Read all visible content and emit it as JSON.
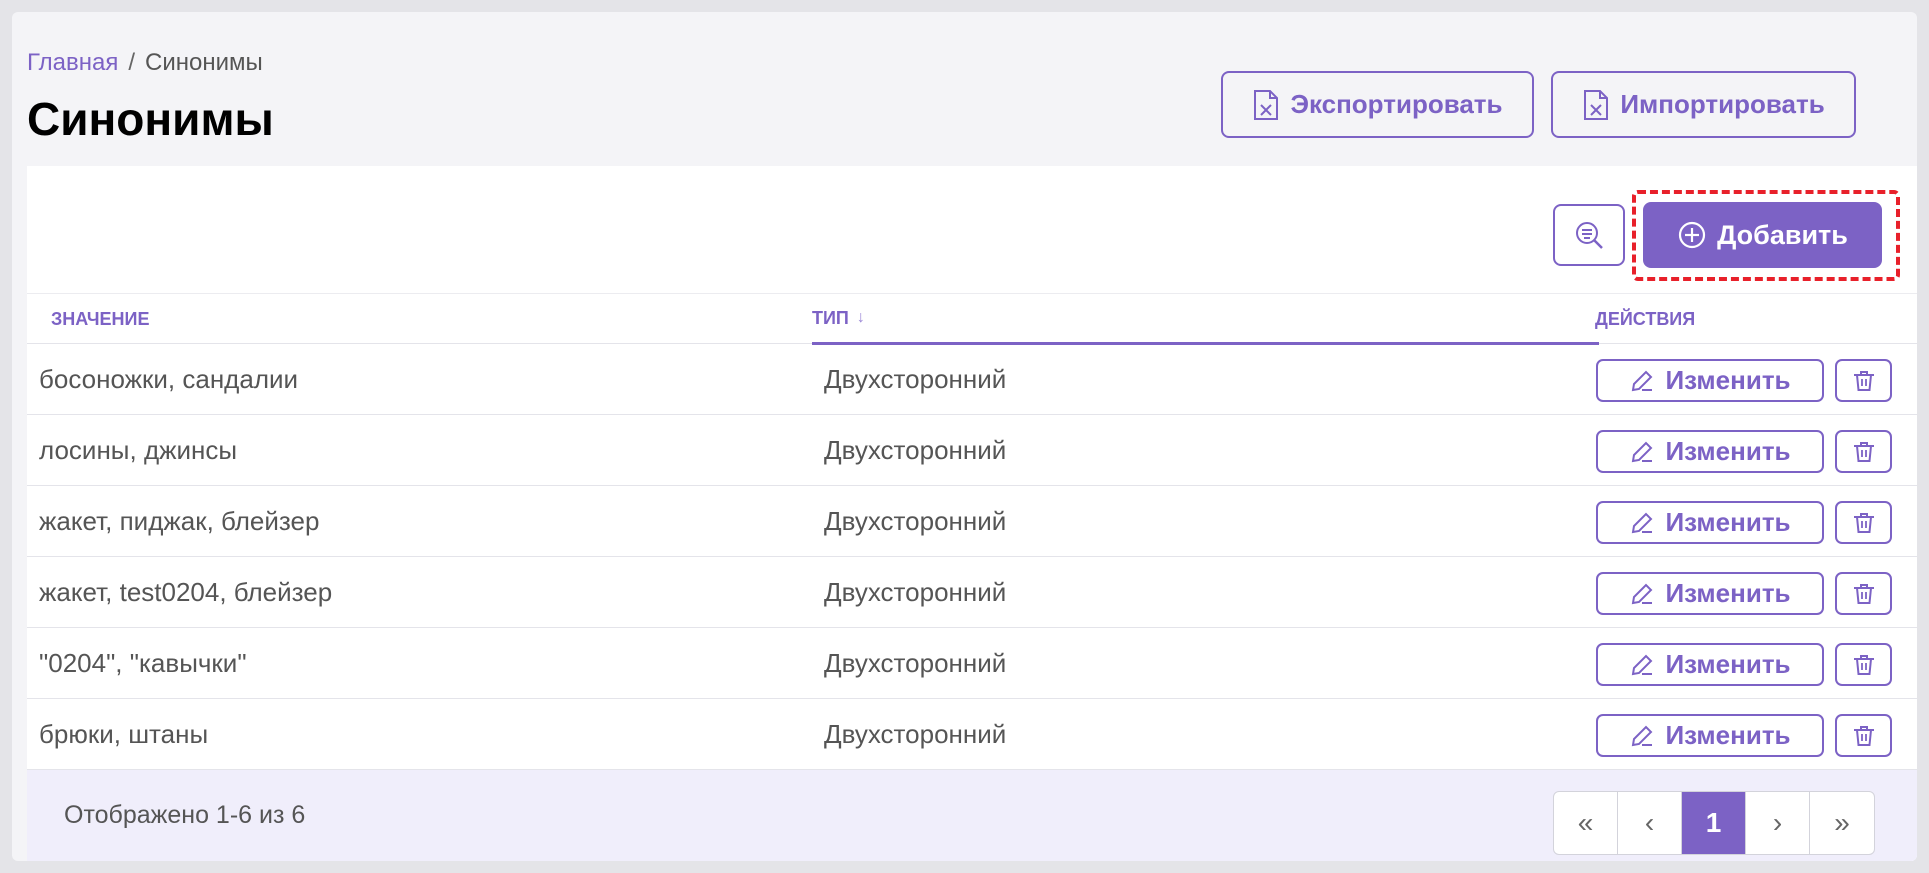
{
  "breadcrumb": {
    "home": "Главная",
    "separator": "/",
    "current": "Синонимы"
  },
  "page": {
    "title": "Синонимы"
  },
  "toolbar": {
    "export_label": "Экспортировать",
    "import_label": "Импортировать",
    "add_label": "Добавить"
  },
  "table": {
    "headers": {
      "value": "Значение",
      "type": "Тип",
      "type_sort_glyph": "↓",
      "actions": "Действия"
    },
    "rows": [
      {
        "value": "босоножки, сандалии",
        "type": "Двухсторонний",
        "edit_label": "Изменить"
      },
      {
        "value": "лосины, джинсы",
        "type": "Двухсторонний",
        "edit_label": "Изменить"
      },
      {
        "value": "жакет, пиджак, блейзер",
        "type": "Двухсторонний",
        "edit_label": "Изменить"
      },
      {
        "value": "жакет, test0204, блейзер",
        "type": "Двухсторонний",
        "edit_label": "Изменить"
      },
      {
        "value": "\"0204\", \"кавычки\"",
        "type": "Двухсторонний",
        "edit_label": "Изменить"
      },
      {
        "value": "брюки, штаны",
        "type": "Двухсторонний",
        "edit_label": "Изменить"
      }
    ]
  },
  "footer": {
    "info": "Отображено 1-6 из 6",
    "pagination": {
      "first": "«",
      "prev": "‹",
      "current_page": "1",
      "next": "›",
      "last": "»"
    }
  },
  "colors": {
    "accent": "#7c62c5",
    "highlight": "#e8202a",
    "footer_bg": "#f0eefb"
  },
  "icons": {
    "export": "excel-file-icon",
    "import": "excel-file-icon",
    "search": "search-filter-icon",
    "add": "plus-circle-icon",
    "edit": "pencil-icon",
    "delete": "trash-icon"
  }
}
